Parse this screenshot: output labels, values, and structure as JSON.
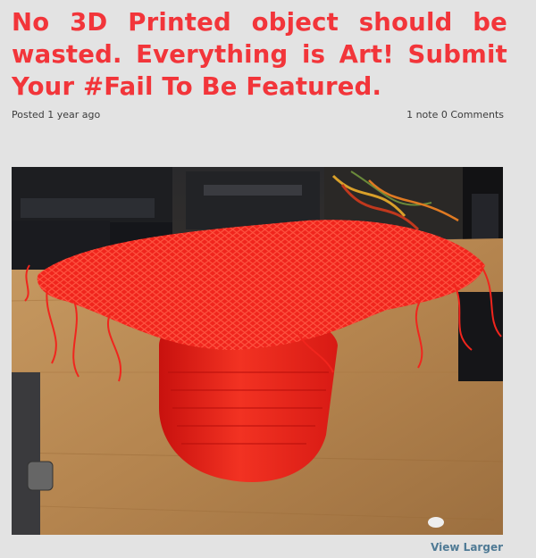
{
  "post": {
    "title": "No 3D Printed object should be wasted. Everything is Art! Submit Your #Fail To Be Featured.",
    "posted": "Posted 1 year ago",
    "notes": "1 note",
    "comments": "0 Comments",
    "view_larger": "View Larger"
  },
  "photo": {
    "subject": "failed red 3D print with stringy mesh top on a wooden workbench",
    "colors": {
      "print": "#f0251d",
      "wood": "#b98a55",
      "machine": "#1c1d20"
    }
  },
  "theme": {
    "title_color": "#f2353a",
    "link_color": "#4f7a95",
    "background": "#e3e3e3"
  }
}
